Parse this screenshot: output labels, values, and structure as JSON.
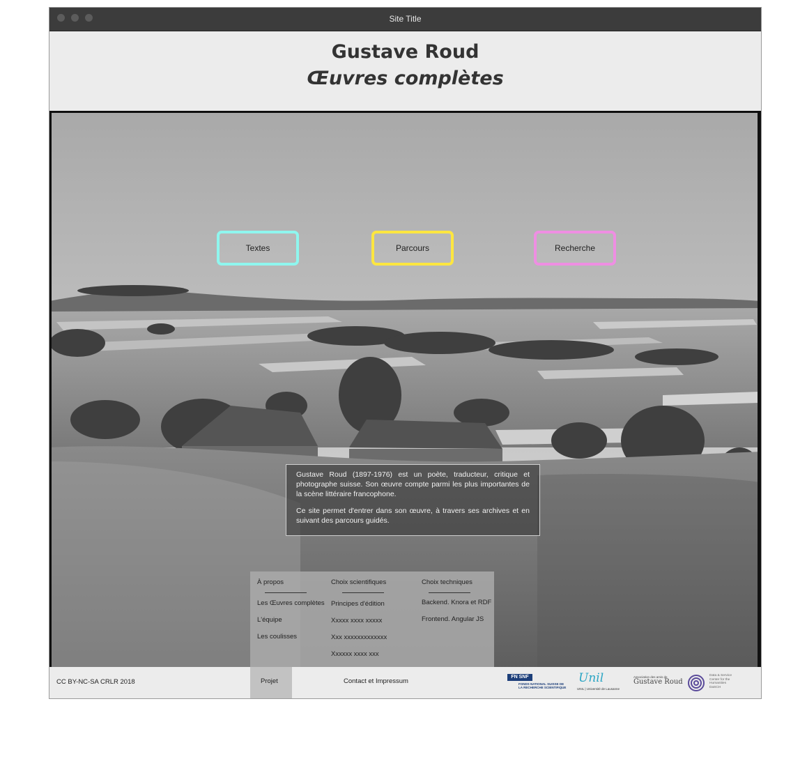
{
  "window": {
    "title": "Site Title"
  },
  "header": {
    "title": "Gustave Roud",
    "subtitle": "Œuvres complètes"
  },
  "nav": {
    "buttons": [
      {
        "label": "Textes",
        "color": "#8ff6ee"
      },
      {
        "label": "Parcours",
        "color": "#fde640"
      },
      {
        "label": "Recherche",
        "color": "#ee8ee2"
      }
    ]
  },
  "intro": {
    "p1": "Gustave Roud (1897-1976) est un poète, traducteur, critique et photographe suisse. Son œuvre compte parmi les plus importantes de la scène littéraire francophone.",
    "p2": "Ce site permet d'entrer dans son œuvre, à travers ses archives et en suivant des parcours guidés."
  },
  "menu": {
    "columns": [
      {
        "heading": "À propos",
        "items": [
          "Les Œuvres complètes",
          "L'équipe",
          "Les coulisses"
        ]
      },
      {
        "heading": "Choix scientifiques",
        "items": [
          "Principes d'édition",
          "Xxxxx xxxx xxxxx",
          "Xxx xxxxxxxxxxxxx",
          "Xxxxxx xxxx xxx"
        ]
      },
      {
        "heading": "Choix techniques",
        "items": [
          "Backend. Knora et RDF",
          "Frontend. Angular JS"
        ]
      }
    ]
  },
  "footer": {
    "license": "CC BY-NC-SA CRLR 2018",
    "projet": "Projet",
    "contact": "Contact et Impressum",
    "logos": {
      "fnsnf_top": "FN SNF",
      "fnsnf_bottom": "FONDS NATIONAL SUISSE DE LA RECHERCHE SCIENTIFIQUE",
      "unil_word": "Unil",
      "unil_sub": "UNIL | Université de Lausanne",
      "amis_small": "Association des amis de",
      "amis_big": "Gustave Roud",
      "dasch": "Data & Service Center for the Humanities DaSCH"
    }
  }
}
